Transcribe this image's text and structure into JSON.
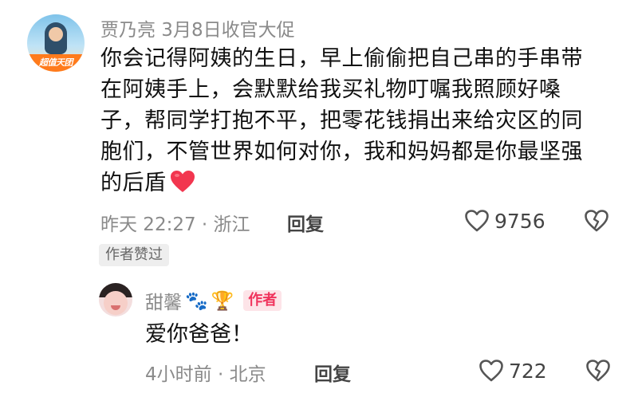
{
  "main_comment": {
    "avatar_badge_text": "超值天团",
    "author_line": "贾乃亮 3月8日收官大促",
    "text": "你会记得阿姨的生日，早上偷偷把自己串的手串带在阿姨手上，会默默给我买礼物叮嘱我照顾好嗓子，帮同学打抱不平，把零花钱捐出来给灾区的同胞们，不管世界如何对你，我和妈妈都是你最坚强的后盾",
    "trailing_emoji": "red-heart",
    "time_location": "昨天 22:27 · 浙江",
    "reply_label": "回复",
    "like_count": "9756",
    "author_liked_badge": "作者赞过"
  },
  "reply": {
    "author_name": "甜馨",
    "name_emojis": [
      "🐾",
      "🏆"
    ],
    "author_tag": "作者",
    "text": "爱你爸爸！",
    "time_location": "4小时前 · 北京",
    "reply_label": "回复",
    "like_count": "722"
  },
  "colors": {
    "accent_red": "#f0335c",
    "meta_gray": "#8a8a8a",
    "text_dark": "#111111"
  }
}
